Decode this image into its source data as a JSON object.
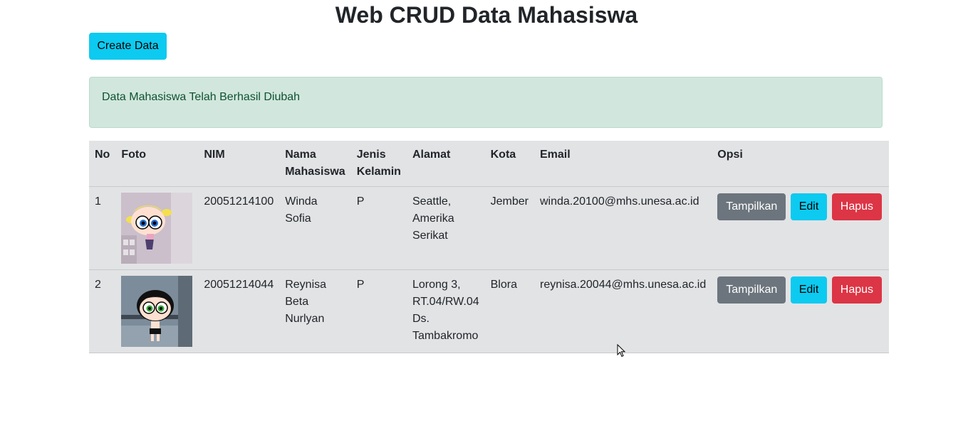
{
  "header": {
    "title": "Web CRUD Data Mahasiswa"
  },
  "toolbar": {
    "create_label": "Create Data"
  },
  "alert": {
    "message": "Data Mahasiswa Telah Berhasil Diubah"
  },
  "table": {
    "headers": {
      "no": "No",
      "foto": "Foto",
      "nim": "NIM",
      "nama": "Nama Mahasiswa",
      "jk": "Jenis Kelamin",
      "alamat": "Alamat",
      "kota": "Kota",
      "email": "Email",
      "opsi": "Opsi"
    },
    "rows": [
      {
        "no": "1",
        "foto": "bubbles-image",
        "nim": "20051214100",
        "nama": "Winda Sofia",
        "jk": "P",
        "alamat": "Seattle, Amerika Serikat",
        "kota": "Jember",
        "email": "winda.20100@mhs.unesa.ac.id",
        "show_label": "Tampilkan",
        "edit_label": "Edit",
        "delete_label": "Hapus"
      },
      {
        "no": "2",
        "foto": "buttercup-image",
        "nim": "20051214044",
        "nama": "Reynisa Beta Nurlyan",
        "jk": "P",
        "alamat": "Lorong 3, RT.04/RW.04 Ds. Tambakromo",
        "kota": "Blora",
        "email": "reynisa.20044@mhs.unesa.ac.id",
        "show_label": "Tampilkan",
        "edit_label": "Edit",
        "delete_label": "Hapus"
      }
    ]
  },
  "colors": {
    "info": "#0dcaf0",
    "secondary": "#6c757d",
    "danger": "#dc3545",
    "alert_bg": "#d1e7dd",
    "alert_text": "#0f5132",
    "table_bg": "#e2e3e5"
  }
}
